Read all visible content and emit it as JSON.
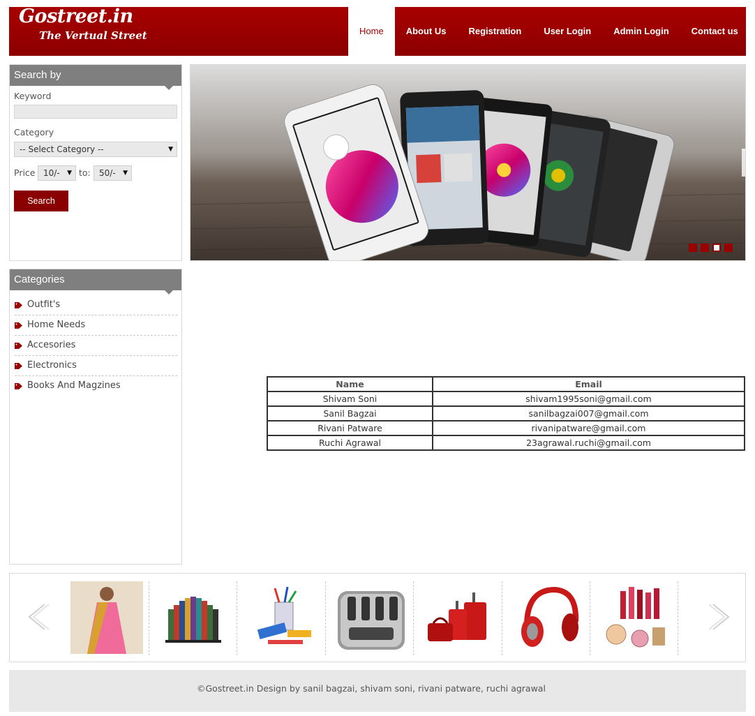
{
  "header": {
    "logo_line1": "Gostreet.in",
    "logo_line2": "The Vertual Street",
    "nav": [
      "Home",
      "About Us",
      "Registration",
      "User Login",
      "Admin Login",
      "Contact us"
    ],
    "active_nav": "Home"
  },
  "search": {
    "title": "Search by",
    "keyword_label": "Keyword",
    "keyword_value": "",
    "category_label": "Category",
    "category_value": "-- Select Category --",
    "price_label": "Price",
    "price_from": "10/-",
    "to_label": "to:",
    "price_to": "50/-",
    "button": "Search"
  },
  "slider": {
    "active_dot": 3,
    "dot_count": 4
  },
  "categories": {
    "title": "Categories",
    "items": [
      "Outfit's",
      "Home Needs",
      "Accesories",
      "Electronics",
      "Books And Magzines"
    ]
  },
  "contacts": {
    "headers": [
      "Name",
      "Email"
    ],
    "rows": [
      [
        "Shivam Soni",
        "shivam1995soni@gmail.com"
      ],
      [
        "Sanil Bagzai",
        "sanilbagzai007@gmail.com"
      ],
      [
        "Rivani Patware",
        "rivanipatware@gmail.com"
      ],
      [
        "Ruchi Agrawal",
        "23agrawal.ruchi@gmail.com"
      ]
    ]
  },
  "carousel": {
    "items": [
      "saree",
      "books",
      "stationery",
      "toaster",
      "luggage",
      "headphones",
      "cosmetics"
    ]
  },
  "footer": {
    "text": "©Gostreet.in Design by sanil bagzai, shivam soni, rivani patware, ruchi agrawal"
  },
  "colors": {
    "brand": "#9e0000",
    "panel_head": "#7f7f7f",
    "footer_bg": "#e8e8e8"
  }
}
